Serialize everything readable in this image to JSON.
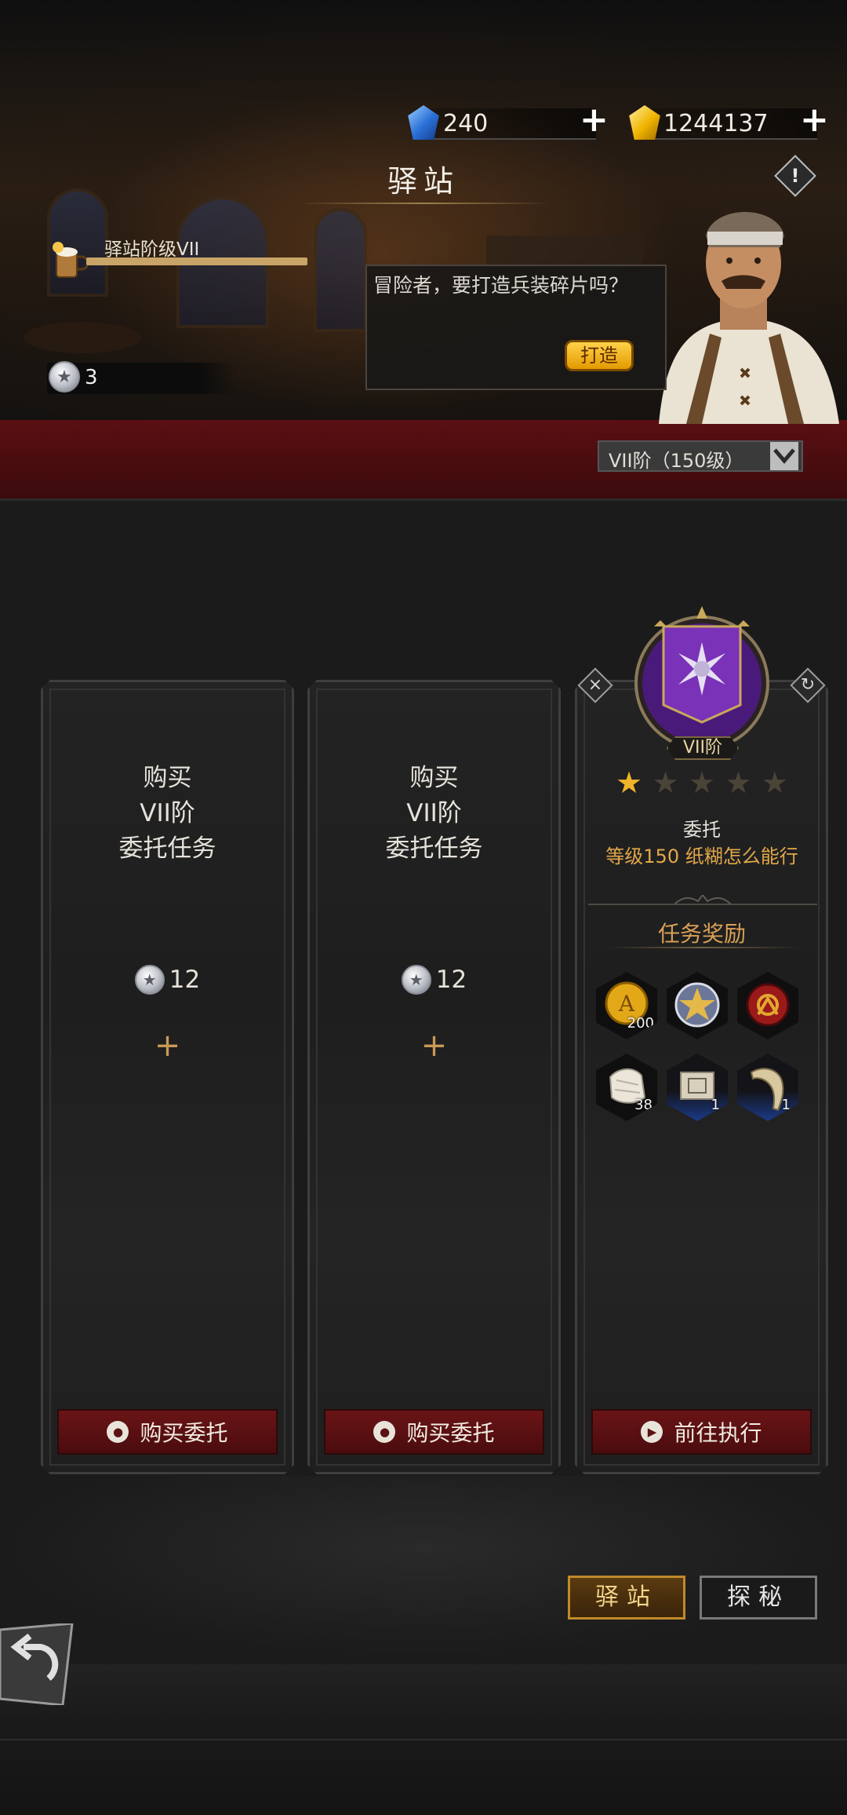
{
  "header": {
    "title": "驿站",
    "currencies": [
      {
        "icon": "blue-crystal-icon",
        "value": "240"
      },
      {
        "icon": "gold-crystal-icon",
        "value": "1244137"
      }
    ],
    "plus_label": "+",
    "info_label": "!"
  },
  "station": {
    "level_label": "驿站阶级VII",
    "token_count": "3"
  },
  "dialog": {
    "text": "冒险者，要打造兵装碎片吗？",
    "forge_button": "打造"
  },
  "tier_selector": {
    "label": "VII阶（150级）"
  },
  "slots": [
    {
      "title_lines": [
        "购买",
        "VII阶",
        "委托任务"
      ],
      "cost": "12",
      "plus": "+",
      "button": "购买委托"
    },
    {
      "title_lines": [
        "购买",
        "VII阶",
        "委托任务"
      ],
      "cost": "12",
      "plus": "+",
      "button": "购买委托"
    }
  ],
  "task": {
    "tier_badge": "VII阶",
    "stars_total": 5,
    "stars_filled": 1,
    "type": "委托",
    "description": "等级150 纸糊怎么能行",
    "rewards_title": "任务奖励",
    "rewards": [
      {
        "icon": "gold-coin-icon",
        "count": "200"
      },
      {
        "icon": "silver-star-medal-icon",
        "count": ""
      },
      {
        "icon": "red-emblem-coin-icon",
        "count": ""
      },
      {
        "icon": "white-cloth-icon",
        "count": "38"
      },
      {
        "icon": "blueprint-scroll-icon",
        "count": "1"
      },
      {
        "icon": "horn-icon",
        "count": "1"
      }
    ],
    "button": "前往执行"
  },
  "bottom_tabs": {
    "station": "驿站",
    "explore": "探秘"
  },
  "colors": {
    "accent_gold": "#e3a84a",
    "button_red": "#5a1214",
    "banner_purple": "#6a2aa8"
  }
}
